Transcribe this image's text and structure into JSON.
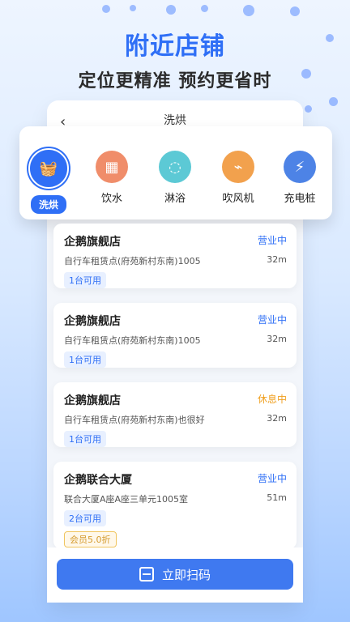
{
  "header": {
    "title": "附近店铺",
    "subtitle": "定位更精准 预约更省时"
  },
  "phone": {
    "back_icon": "back-arrow-icon",
    "title": "洗烘"
  },
  "categories": [
    {
      "label": "洗烘",
      "icon": "washer-icon",
      "active": true
    },
    {
      "label": "饮水",
      "icon": "water-dispenser-icon",
      "active": false
    },
    {
      "label": "淋浴",
      "icon": "shower-icon",
      "active": false
    },
    {
      "label": "吹风机",
      "icon": "hair-dryer-icon",
      "active": false
    },
    {
      "label": "充电桩",
      "icon": "charging-pile-icon",
      "active": false
    }
  ],
  "stores": [
    {
      "name": "企鹅旗舰店",
      "status": "营业中",
      "address": "自行车租赁点(府苑新村东南)1005",
      "distance": "32m",
      "availability": "1台可用"
    },
    {
      "name": "企鹅旗舰店",
      "status": "营业中",
      "address": "自行车租赁点(府苑新村东南)1005",
      "distance": "32m",
      "availability": "1台可用"
    },
    {
      "name": "企鹅旗舰店",
      "status": "休息中",
      "address": "自行车租赁点(府苑新村东南)也很好",
      "distance": "32m",
      "availability": "1台可用"
    },
    {
      "name": "企鹅联合大厦",
      "status": "营业中",
      "address": "联合大厦A座A座三单元1005室",
      "distance": "51m",
      "availability": "2台可用",
      "vip": "会员5.0折"
    }
  ],
  "scan_button": {
    "label": "立即扫码"
  },
  "colors": {
    "accent": "#2f6ff6",
    "status_open": "#2f6ff6",
    "status_closed": "#f0a020"
  }
}
